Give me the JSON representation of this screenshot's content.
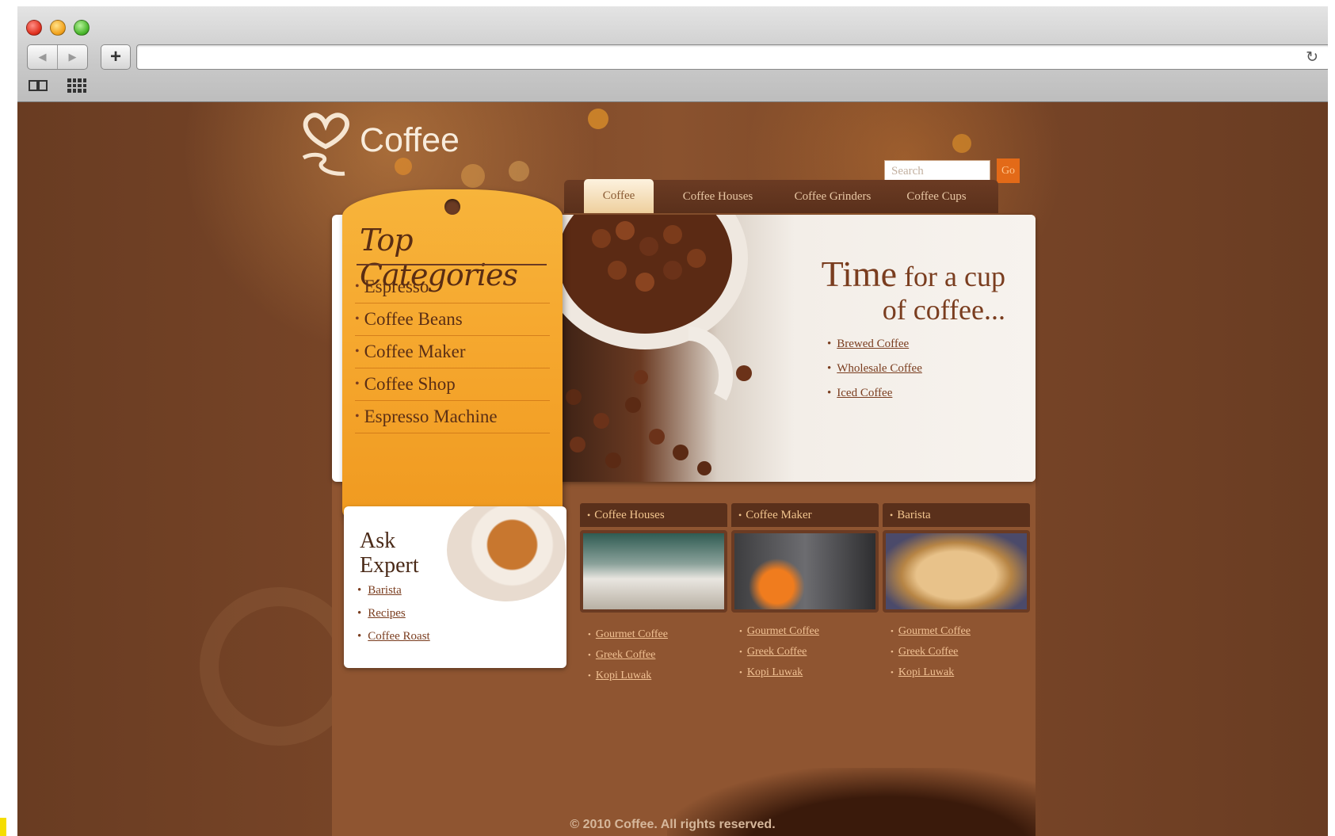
{
  "browser": {
    "back_label": "◀",
    "forward_label": "▶",
    "add_label": "+",
    "url": "",
    "reload_label": "↻"
  },
  "site": {
    "logo_text": "Coffee",
    "search_placeholder": "Search",
    "go_label": "Go",
    "nav_tabs": [
      "Coffee",
      "Coffee Houses",
      "Coffee Grinders",
      "Coffee Cups"
    ],
    "active_tab": "Coffee"
  },
  "categories": {
    "title": "Top Categories",
    "items": [
      "Espresso",
      "Coffee Beans",
      "Coffee Maker",
      "Coffee Shop",
      "Espresso Machine"
    ]
  },
  "hero": {
    "title_word": "Time",
    "title_rest": " for a cup",
    "title_line2": "of coffee...",
    "links": [
      "Brewed Coffee",
      "Wholesale Coffee",
      "Iced Coffee"
    ]
  },
  "expert": {
    "title_line1": "Ask",
    "title_line2": "Expert",
    "links": [
      "Barista",
      "Recipes",
      "Coffee Roast"
    ]
  },
  "columns": [
    {
      "title": "Coffee Houses",
      "links": [
        "Gourmet Coffee",
        "Greek Coffee",
        "Kopi Luwak"
      ]
    },
    {
      "title": "Coffee Maker",
      "links": [
        "Gourmet Coffee",
        "Greek Coffee",
        "Kopi Luwak"
      ]
    },
    {
      "title": "Barista",
      "links": [
        "Gourmet Coffee",
        "Greek Coffee",
        "Kopi Luwak"
      ]
    }
  ],
  "footer": "© 2010 Coffee. All rights reserved.",
  "colors": {
    "page_background": "#7a4628",
    "accent_orange": "#f6a930",
    "go_button": "#e36a18",
    "dark_brown": "#5a301b"
  }
}
